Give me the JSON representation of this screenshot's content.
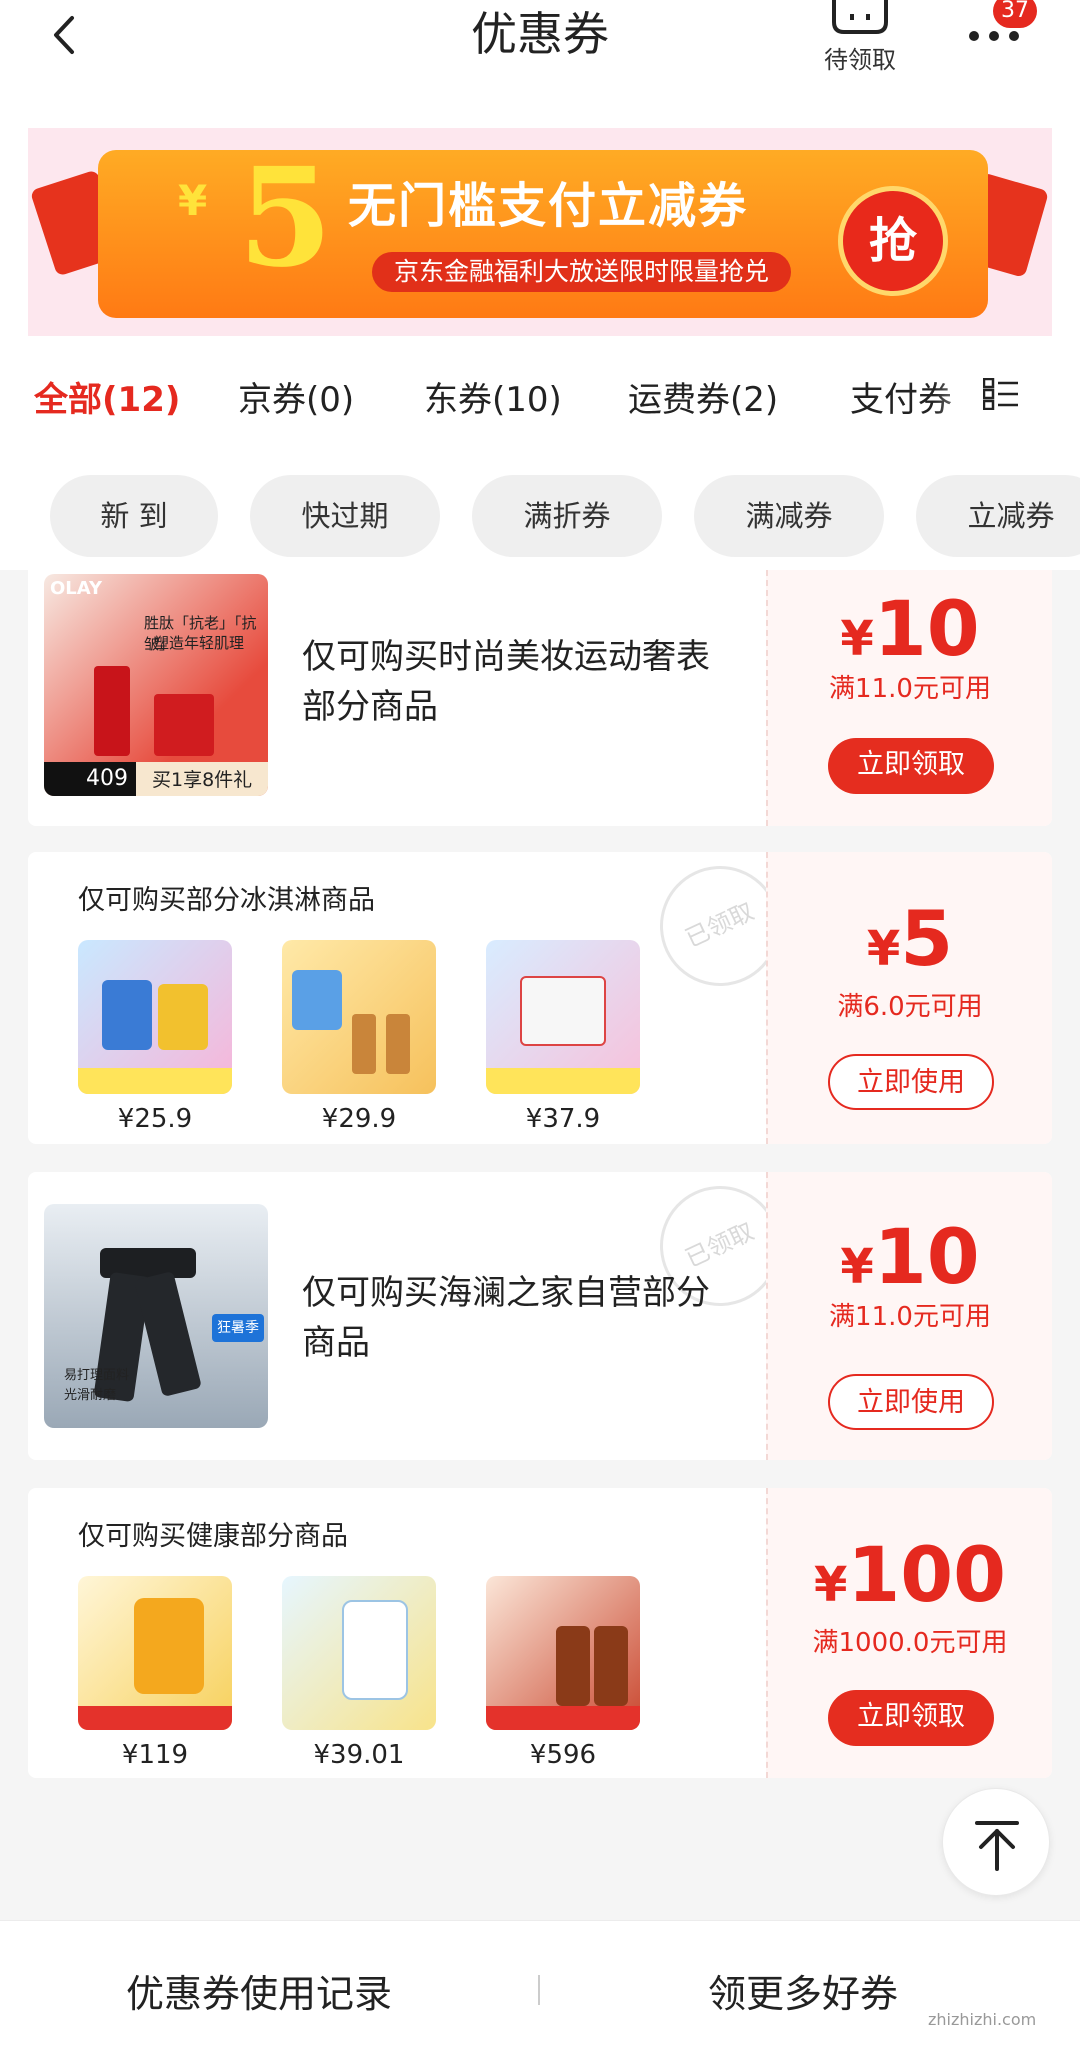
{
  "header": {
    "title": "优惠券",
    "pending_label": "待领取",
    "badge_count": "37"
  },
  "banner": {
    "currency": "¥",
    "amount": "5",
    "title": "无门槛支付立减券",
    "subtitle": "京东金融福利大放送限时限量抢兑",
    "grab_label": "抢"
  },
  "tabs": [
    {
      "label": "全部(12)",
      "active": true
    },
    {
      "label": "京券(0)"
    },
    {
      "label": "东券(10)"
    },
    {
      "label": "运费券(2)"
    },
    {
      "label": "支付券"
    }
  ],
  "chips": [
    "新 到",
    "快过期",
    "满折券",
    "满减券",
    "立减券"
  ],
  "coupons": [
    {
      "text": "仅可购买时尚美妆运动奢表部分商品",
      "currency": "¥",
      "amount": "10",
      "condition": "满11.0元可用",
      "button": "立即领取",
      "thumb_text": [
        "OLAY",
        "胜肽「抗老」「抗皱」",
        "塑造年轻肌理",
        "409",
        "买1享8件礼"
      ]
    },
    {
      "subtitle": "仅可购买部分冰淇淋商品",
      "currency": "¥",
      "amount": "5",
      "condition": "满6.0元可用",
      "button": "立即使用",
      "stamp": "已领取",
      "prices": [
        "¥25.9",
        "¥29.9",
        "¥37.9"
      ]
    },
    {
      "text": "仅可购买海澜之家自营部分商品",
      "currency": "¥",
      "amount": "10",
      "condition": "满11.0元可用",
      "button": "立即使用",
      "stamp": "已领取",
      "thumb_text": [
        "狂暑季",
        "易打理面料",
        "光滑耐磨"
      ]
    },
    {
      "subtitle": "仅可购买健康部分商品",
      "currency": "¥",
      "amount": "100",
      "condition": "满1000.0元可用",
      "button": "立即领取",
      "prices": [
        "¥119",
        "¥39.01",
        "¥596"
      ]
    }
  ],
  "footer": {
    "left": "优惠券使用记录",
    "right": "领更多好券"
  },
  "watermark": "zhizhizhi.com",
  "colors": {
    "accent": "#e5291f",
    "banner_orange": "#ff8a1a"
  }
}
